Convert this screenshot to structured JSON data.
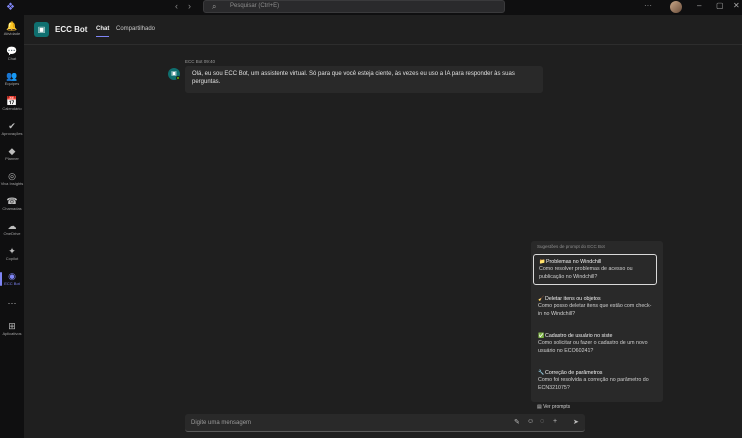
{
  "titlebar": {
    "search_placeholder": "Pesquisar (Ctrl+E)",
    "colors": {
      "accent": "#7f85f5"
    }
  },
  "rail": {
    "items": [
      {
        "label": "Atividade",
        "icon": "bell-icon",
        "glyph": "🔔"
      },
      {
        "label": "Chat",
        "icon": "chat-icon",
        "glyph": "💬"
      },
      {
        "label": "Equipes",
        "icon": "teams-icon",
        "glyph": "👥"
      },
      {
        "label": "Calendário",
        "icon": "calendar-icon",
        "glyph": "📅"
      },
      {
        "label": "Aprovações",
        "icon": "approvals-icon",
        "glyph": "✔"
      },
      {
        "label": "Planner",
        "icon": "planner-icon",
        "glyph": "◆"
      },
      {
        "label": "Viva Insights",
        "icon": "insights-icon",
        "glyph": "◎"
      },
      {
        "label": "Chamadas",
        "icon": "phone-icon",
        "glyph": "☎"
      },
      {
        "label": "OneDrive",
        "icon": "cloud-icon",
        "glyph": "☁"
      },
      {
        "label": "Copilot",
        "icon": "copilot-icon",
        "glyph": "✦"
      },
      {
        "label": "ECC Bot",
        "icon": "bot-icon",
        "glyph": "◉"
      },
      {
        "label": "",
        "icon": "more-icon",
        "glyph": "···"
      },
      {
        "label": "Aplicativos",
        "icon": "apps-icon",
        "glyph": "⊞"
      }
    ]
  },
  "header": {
    "title": "ECC Bot",
    "tabs": [
      "Chat",
      "Compartilhado"
    ]
  },
  "message": {
    "sender": "ECC Bot",
    "time": "09:40",
    "text": "Olá, eu sou ECC Bot, um assistente virtual. Só para que você esteja ciente, às vezes eu uso a IA para responder às suas perguntas."
  },
  "suggestions": {
    "heading": "Sugestões de prompt do ECC Bot",
    "items": [
      {
        "emoji": "📁",
        "title": "Problemas no Windchill",
        "desc": "Como resolver problemas de acesso ou publicação no Windchill?"
      },
      {
        "emoji": "🧹",
        "title": "Deletar itens ou objetos",
        "desc": "Como posso deletar itens que estão com check-in no Windchill?"
      },
      {
        "emoji": "✅",
        "title": "Cadastro de usuário no siste",
        "desc": "Como solicitar ou fazer o cadastro de um novo usuário no ECO60241?"
      },
      {
        "emoji": "🔧",
        "title": "Correção de parâmetros",
        "desc": "Como foi resolvida a correção no parâmetro do ECN321075?"
      }
    ],
    "footer": "Ver prompts"
  },
  "compose": {
    "placeholder": "Digite uma mensagem"
  }
}
